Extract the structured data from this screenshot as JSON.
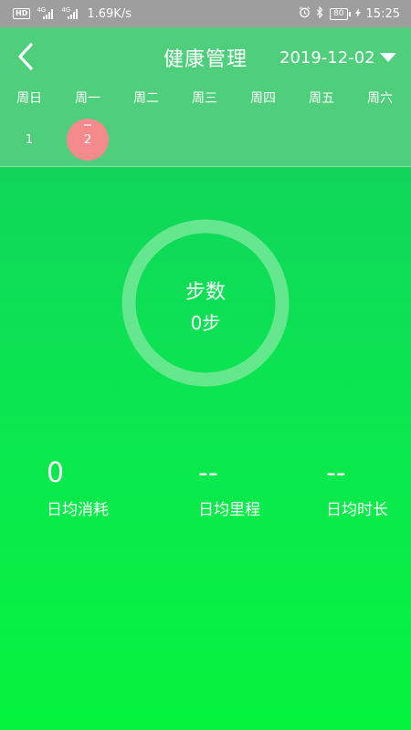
{
  "status_bar": {
    "network_hd": "HD",
    "signal1_tag": "4G",
    "signal2_tag": "4G",
    "speed": "1.69K/s",
    "battery": "80",
    "time": "15:25"
  },
  "header": {
    "title": "健康管理",
    "date": "2019-12-02"
  },
  "weekdays": [
    "周日",
    "周一",
    "周二",
    "周三",
    "周四",
    "周五",
    "周六"
  ],
  "days": [
    {
      "label": "1",
      "selected": false
    },
    {
      "label": "2",
      "selected": true
    }
  ],
  "steps": {
    "label": "步数",
    "value": "0步"
  },
  "stats": [
    {
      "value": "0",
      "label": "日均消耗"
    },
    {
      "value": "--",
      "label": "日均里程"
    },
    {
      "value": "--",
      "label": "日均时长"
    }
  ],
  "colors": {
    "header_bg": "#4fce7c",
    "gradient_top": "#15cb62",
    "gradient_bottom": "#05f53e",
    "selected_day": "#f58a8d",
    "ring": "#6ee895"
  }
}
